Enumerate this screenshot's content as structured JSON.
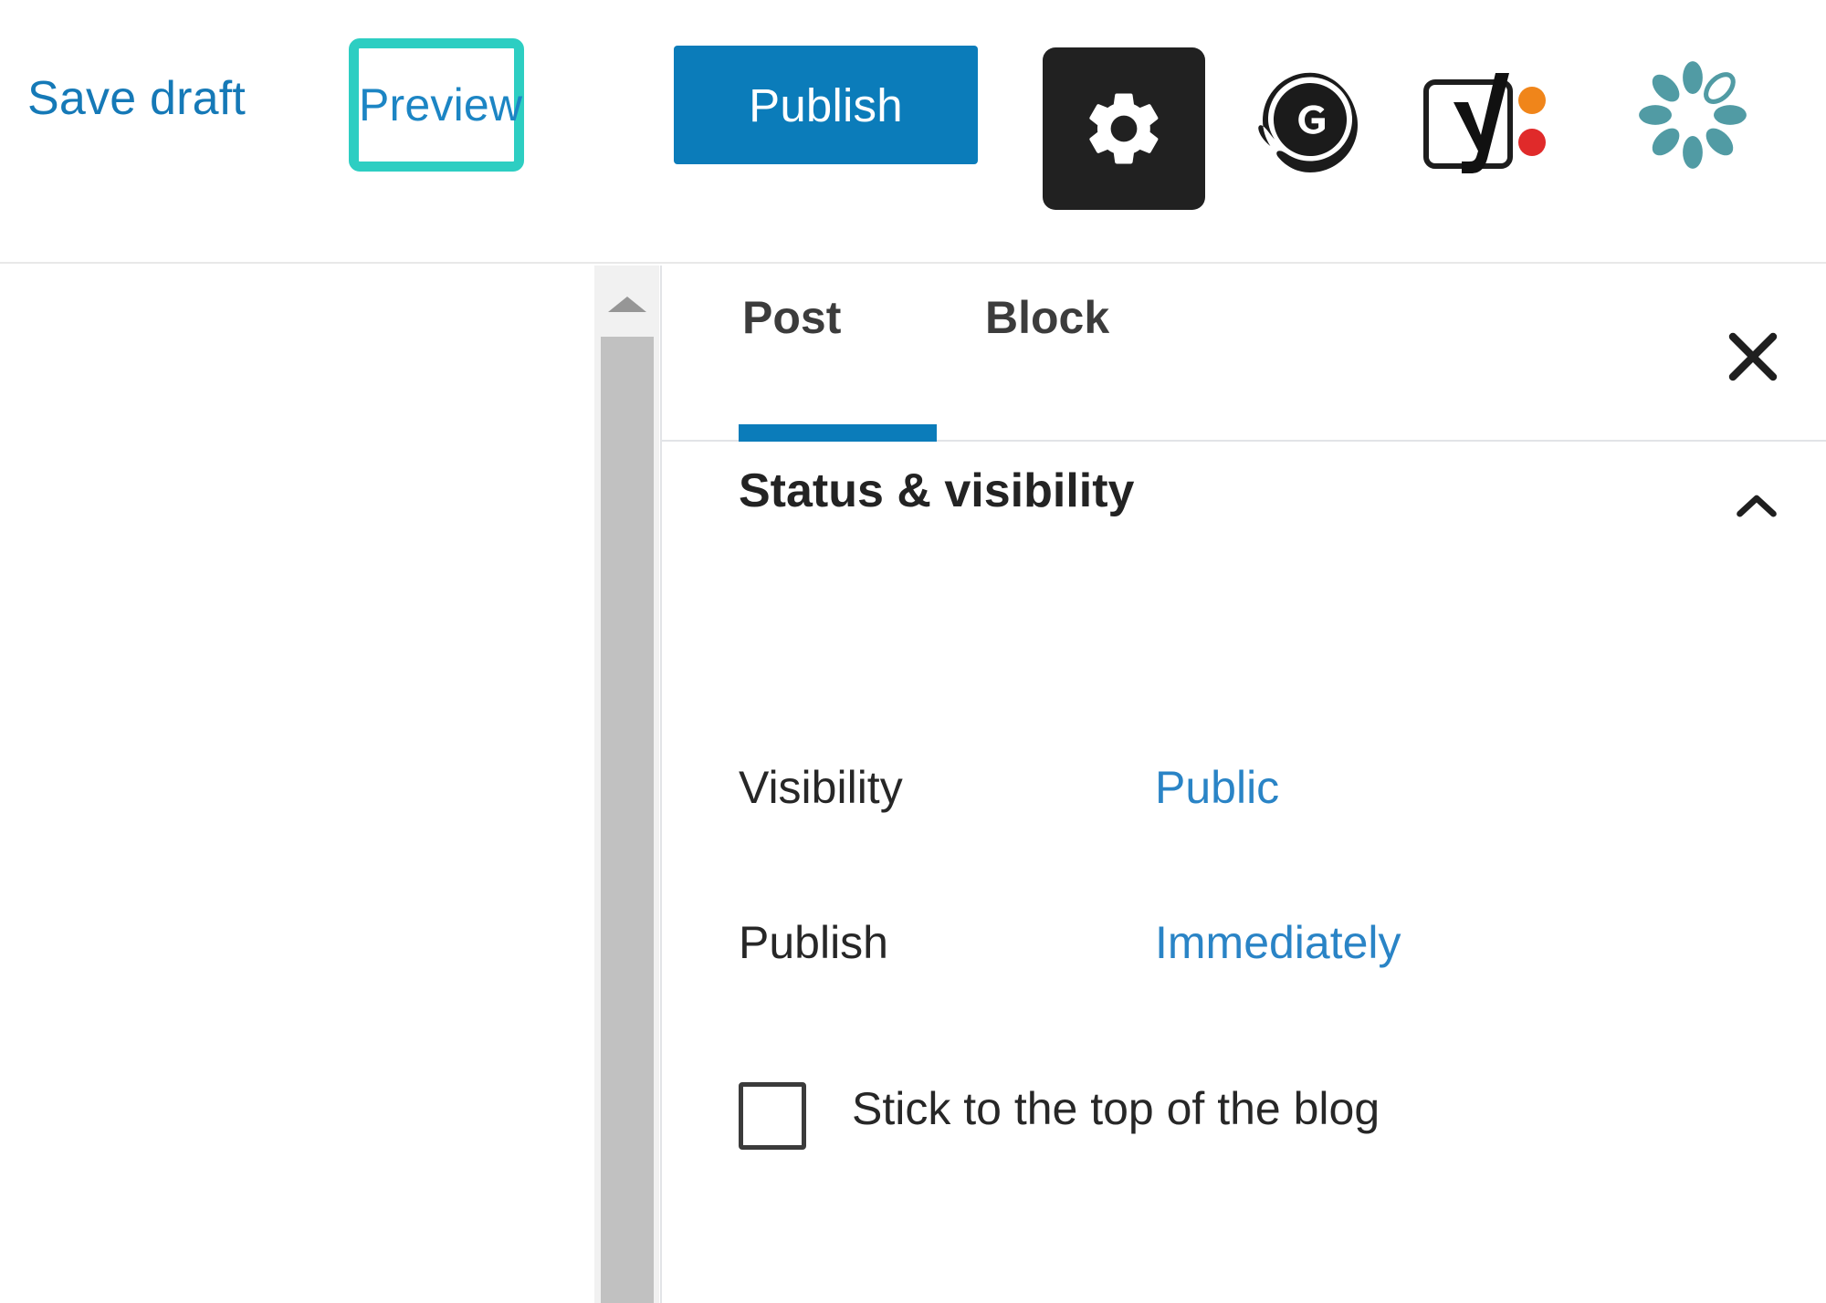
{
  "toolbar": {
    "save_draft_label": "Save draft",
    "preview_label": "Preview",
    "publish_label": "Publish",
    "icons": {
      "settings": "gear-icon",
      "grammarly": "grammarly-icon",
      "yoast": "yoast-seo-icon",
      "flower": "flower-icon"
    },
    "colors": {
      "link_blue": "#1579b7",
      "publish_blue": "#0b7cba",
      "preview_highlight": "#2dcec2",
      "gear_bg": "#212121",
      "yoast_orange": "#f0851a",
      "yoast_red": "#e02a2a",
      "flower_teal": "#519ba4"
    }
  },
  "scrollbar": {
    "up_arrow": "scroll-up-arrow-icon"
  },
  "sidebar": {
    "tabs": [
      {
        "label": "Post",
        "active": true
      },
      {
        "label": "Block",
        "active": false
      }
    ],
    "close_icon": "close-icon",
    "active_indicator_color": "#0b7cba",
    "panel": {
      "title": "Status & visibility",
      "toggle_icon": "chevron-up-icon",
      "rows": [
        {
          "label": "Visibility",
          "value": "Public"
        },
        {
          "label": "Publish",
          "value": "Immediately"
        }
      ],
      "checkbox": {
        "label": "Stick to the top of the blog",
        "checked": false
      }
    }
  }
}
